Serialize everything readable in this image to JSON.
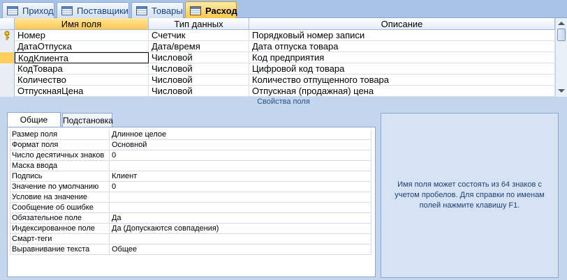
{
  "tabs": [
    {
      "label": "Приход",
      "active": false
    },
    {
      "label": "Поставщики",
      "active": false
    },
    {
      "label": "Товары",
      "active": false
    },
    {
      "label": "Расход",
      "active": true
    }
  ],
  "grid": {
    "headers": {
      "field_name": "Имя поля",
      "data_type": "Тип данных",
      "description": "Описание"
    },
    "rows": [
      {
        "name": "Номер",
        "type": "Счетчик",
        "description": "Порядковый номер записи",
        "primary_key": true
      },
      {
        "name": "ДатаОтпуска",
        "type": "Дата/время",
        "description": "Дата отпуска товара"
      },
      {
        "name": "КодКлиента",
        "type": "Числовой",
        "description": "Код предприятия",
        "current": true
      },
      {
        "name": "КодТовара",
        "type": "Числовой",
        "description": "Цифровой код товара"
      },
      {
        "name": "Количество",
        "type": "Числовой",
        "description": "Количество отпущенного товара"
      },
      {
        "name": "ОтпускнаяЦена",
        "type": "Числовой",
        "description": "Отпускная (продажная) цена"
      }
    ]
  },
  "properties": {
    "title": "Свойства поля",
    "tabs": [
      {
        "label": "Общие",
        "active": true
      },
      {
        "label": "Подстановка",
        "active": false
      }
    ],
    "rows": [
      {
        "label": "Размер поля",
        "value": "Длинное целое"
      },
      {
        "label": "Формат поля",
        "value": "Основной"
      },
      {
        "label": "Число десятичных знаков",
        "value": "0"
      },
      {
        "label": "Маска ввода",
        "value": ""
      },
      {
        "label": "Подпись",
        "value": "Клиент"
      },
      {
        "label": "Значение по умолчанию",
        "value": "0"
      },
      {
        "label": "Условие на значение",
        "value": ""
      },
      {
        "label": "Сообщение об ошибке",
        "value": ""
      },
      {
        "label": "Обязательное поле",
        "value": "Да"
      },
      {
        "label": "Индексированное поле",
        "value": "Да (Допускаются совпадения)"
      },
      {
        "label": "Смарт-теги",
        "value": ""
      },
      {
        "label": "Выравнивание текста",
        "value": "Общее"
      }
    ],
    "help_text": "Имя поля может состоять из 64 знаков с учетом пробелов.  Для справки по именам полей нажмите клавишу F1."
  },
  "icons": {
    "tab": "table-icon",
    "primary_key": "key-icon"
  },
  "colors": {
    "active_tab": "#ffc84a",
    "accent": "#15428b",
    "background": "#c4d6ee"
  }
}
